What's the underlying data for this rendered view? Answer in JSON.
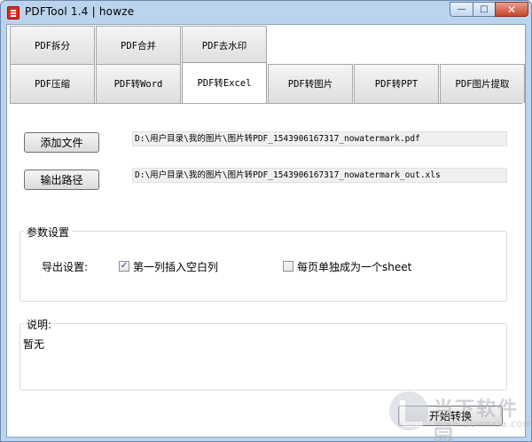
{
  "window": {
    "title": "PDFTool 1.4 | howze",
    "minimize_glyph": "—",
    "maximize_glyph": "□",
    "close_glyph": "✕"
  },
  "tabs_row1": [
    {
      "label": "PDF拆分"
    },
    {
      "label": "PDF合并"
    },
    {
      "label": "PDF去水印"
    }
  ],
  "tabs_row2": [
    {
      "label": "PDF压缩"
    },
    {
      "label": "PDF转Word"
    },
    {
      "label": "PDF转Excel",
      "active": true
    },
    {
      "label": "PDF转图片"
    },
    {
      "label": "PDF转PPT"
    },
    {
      "label": "PDF图片提取"
    }
  ],
  "files": {
    "add_button": "添加文件",
    "input_path": "D:\\用户目录\\我的图片\\图片转PDF_1543906167317_nowatermark.pdf",
    "output_button": "输出路径",
    "output_path": "D:\\用户目录\\我的图片\\图片转PDF_1543906167317_nowatermark_out.xls"
  },
  "settings": {
    "legend": "参数设置",
    "export_label": "导出设置:",
    "option1": {
      "label": "第一列插入空白列",
      "checked": true,
      "mark": "✓"
    },
    "option2": {
      "label": "每页单独成为一个sheet",
      "checked": false,
      "mark": ""
    }
  },
  "notes": {
    "legend": "说明:",
    "text": "暂无"
  },
  "actions": {
    "convert_button": "开始转换"
  },
  "watermark": {
    "brand": "当下软件园",
    "url": "www.downxia.com"
  }
}
